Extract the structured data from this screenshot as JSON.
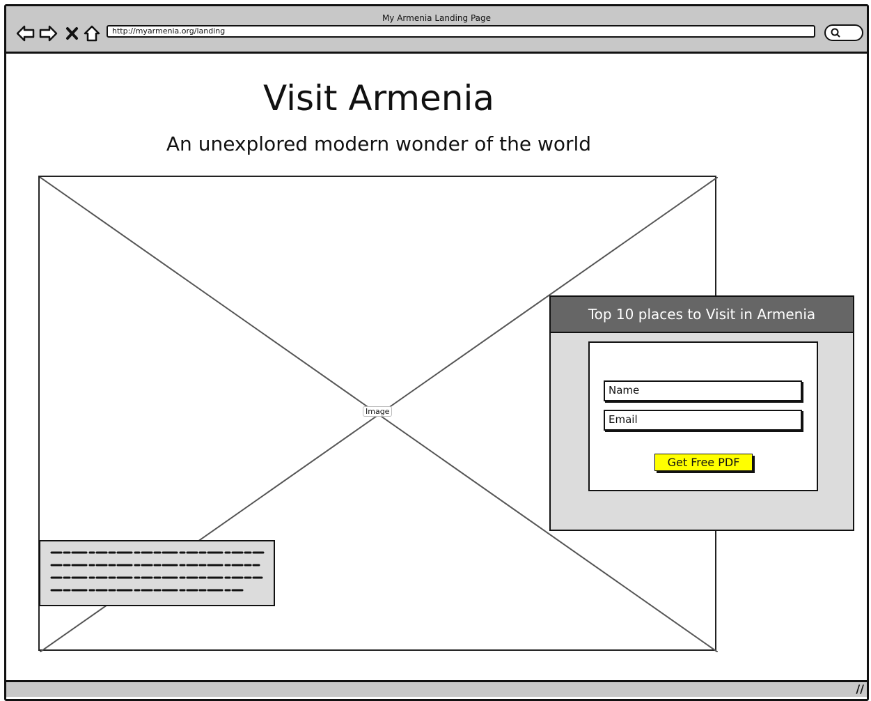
{
  "browser": {
    "window_title": "My Armenia Landing Page",
    "url": "http://myarmenia.org/landing"
  },
  "hero": {
    "title": "Visit Armenia",
    "subtitle": "An unexplored modern wonder of the world",
    "image_label": "Image"
  },
  "signup": {
    "header": "Top 10 places to Visit in Armenia",
    "name_placeholder": "Name",
    "email_placeholder": "Email",
    "cta_label": "Get Free PDF",
    "cta_color": "#ffff00"
  },
  "icons": {
    "back": "arrow-left-icon",
    "forward": "arrow-right-icon",
    "stop": "close-icon",
    "home": "home-icon",
    "search": "search-icon",
    "resize": "resize-grip-icon"
  }
}
